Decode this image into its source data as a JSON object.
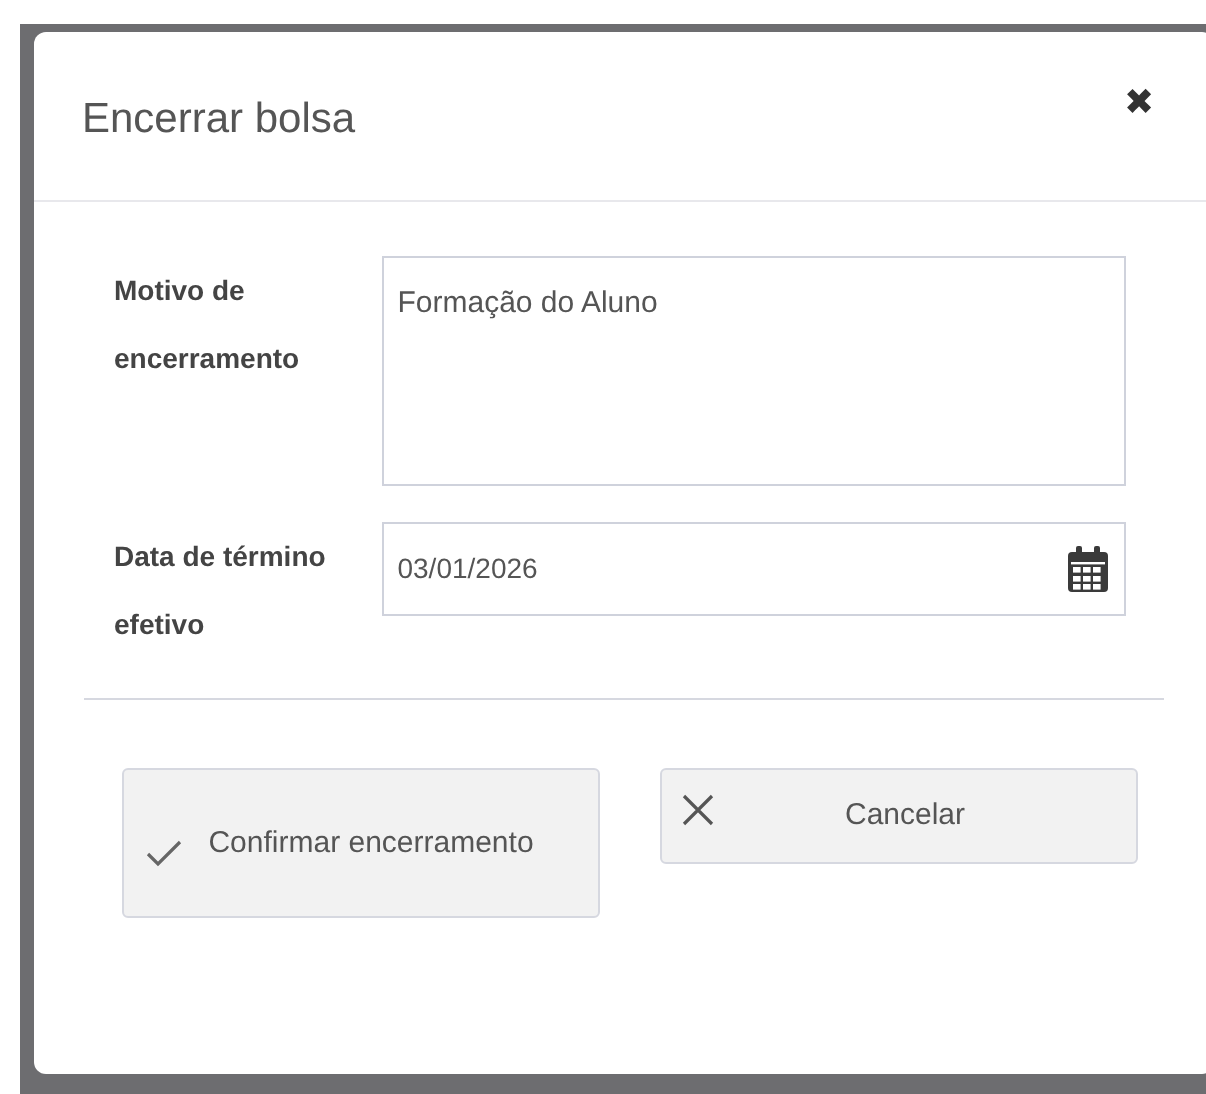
{
  "dialog": {
    "title": "Encerrar bolsa",
    "close": "✖"
  },
  "fields": [
    {
      "kind": "textarea",
      "label": "Motivo de encerramento",
      "value": "Formação do Aluno"
    },
    {
      "kind": "date",
      "label": "Data de término efetivo",
      "value": "03/01/2026"
    }
  ],
  "buttons": [
    {
      "kind": "confirm",
      "label": "Confirmar encerramento"
    },
    {
      "kind": "cancel",
      "label": "Cancelar"
    }
  ]
}
